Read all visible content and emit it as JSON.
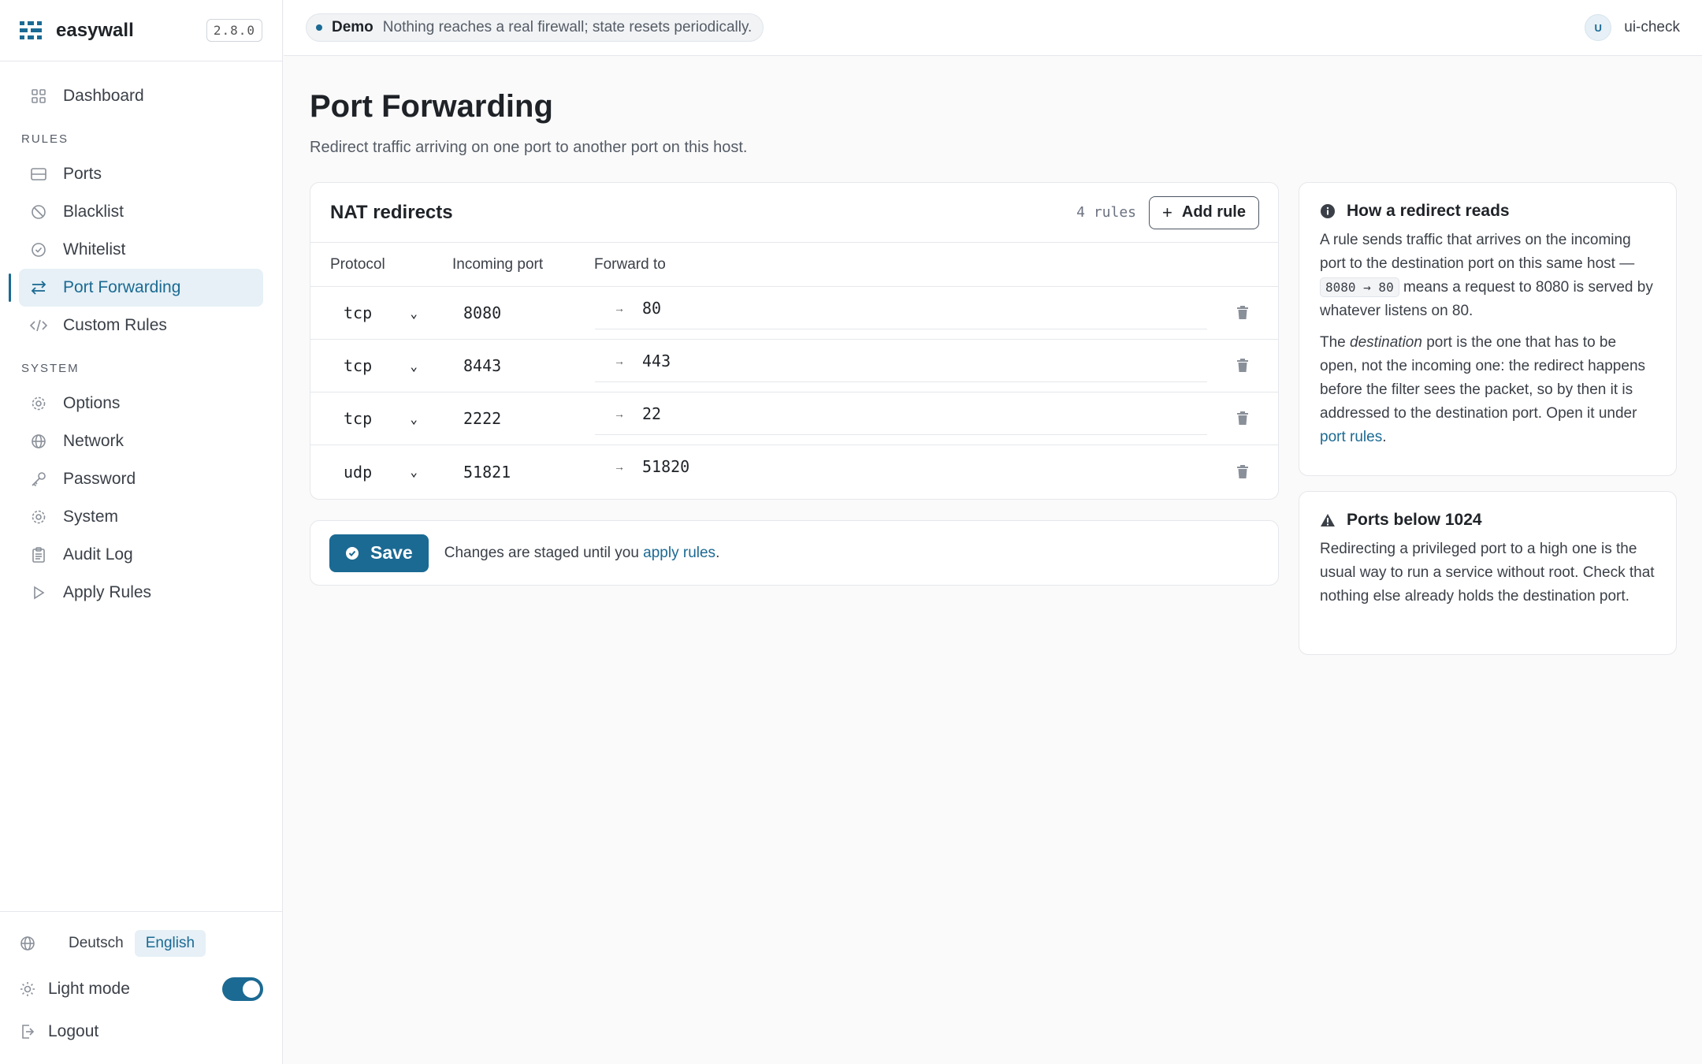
{
  "brand": {
    "name": "easywall",
    "version": "2.8.0"
  },
  "sidebar": {
    "dashboard": "Dashboard",
    "rules_title": "RULES",
    "rules": [
      "Ports",
      "Blacklist",
      "Whitelist",
      "Port Forwarding",
      "Custom Rules"
    ],
    "system_title": "SYSTEM",
    "system": [
      "Options",
      "Network",
      "Password",
      "System",
      "Audit Log",
      "Apply Rules"
    ],
    "active": "Port Forwarding"
  },
  "footer": {
    "lang_de": "Deutsch",
    "lang_en": "English",
    "mode_label": "Light mode",
    "mode_on": true,
    "logout": "Logout"
  },
  "topbar": {
    "demo_title": "Demo",
    "demo_text": "Nothing reaches a real firewall; state resets periodically.",
    "avatar": "U",
    "username": "ui-check"
  },
  "page": {
    "title": "Port Forwarding",
    "subtitle": "Redirect traffic arriving on one port to another port on this host."
  },
  "nat": {
    "title": "NAT redirects",
    "count": "4 rules",
    "add_label": "Add rule",
    "headers": {
      "protocol": "Protocol",
      "incoming": "Incoming port",
      "forward": "Forward to"
    },
    "rows": [
      {
        "protocol": "tcp",
        "incoming": "8080",
        "forward": "80"
      },
      {
        "protocol": "tcp",
        "incoming": "8443",
        "forward": "443"
      },
      {
        "protocol": "tcp",
        "incoming": "2222",
        "forward": "22"
      },
      {
        "protocol": "udp",
        "incoming": "51821",
        "forward": "51820"
      }
    ],
    "arrow": "→"
  },
  "save": {
    "label": "Save",
    "note_before": "Changes are staged until you ",
    "note_link": "apply rules",
    "note_after": "."
  },
  "info": {
    "title": "How a redirect reads",
    "p1_a": "A rule sends traffic that arrives on the incoming port to the destination port on this same host — ",
    "p1_code": "8080 → 80",
    "p1_b": " means a request to 8080 is served by whatever listens on 80.",
    "p2_a": "The ",
    "p2_em": "destination",
    "p2_b": " port is the one that has to be open, not the incoming one: the redirect happens before the filter sees the packet, so by then it is addressed to the destination port. Open it under ",
    "p2_link": "port rules",
    "p2_c": "."
  },
  "warn": {
    "title": "Ports below 1024",
    "text": "Redirecting a privileged port to a high one is the usual way to run a service without root. Check that nothing else already holds the destination port."
  },
  "colors": {
    "accent": "#1b6a93",
    "accent_bg": "#e6f0f6"
  }
}
